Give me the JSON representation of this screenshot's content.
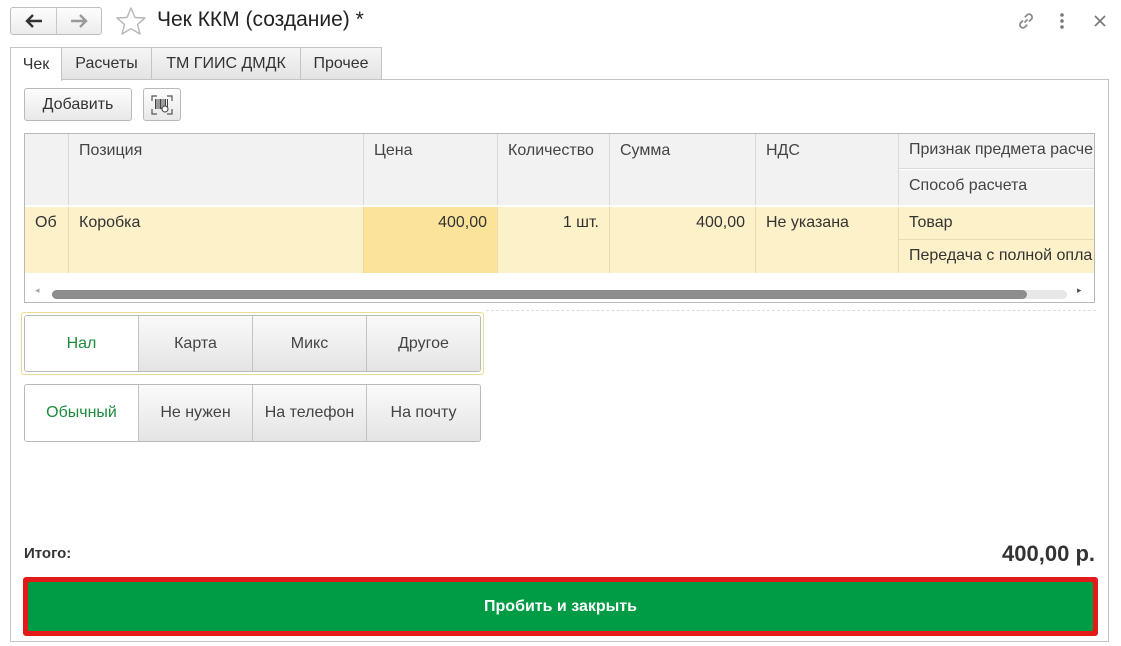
{
  "window": {
    "title": "Чек ККМ (создание) *",
    "icons": [
      "back-arrow-icon",
      "forward-arrow-icon",
      "favorite-star-icon",
      "link-icon",
      "more-vertical-icon",
      "close-icon"
    ]
  },
  "tabs": [
    {
      "label": "Чек",
      "active": true
    },
    {
      "label": "Расчеты",
      "active": false
    },
    {
      "label": "ТМ ГИИС ДМДК",
      "active": false
    },
    {
      "label": "Прочее",
      "active": false
    }
  ],
  "toolbar": {
    "add_label": "Добавить",
    "barcode_icon": "barcode-scan-icon"
  },
  "table": {
    "columns": {
      "position": "Позиция",
      "price": "Цена",
      "quantity": "Количество",
      "sum": "Сумма",
      "vat": "НДС",
      "subject": "Признак предмета расче",
      "method": "Способ расчета"
    },
    "rows": [
      {
        "code": "Об",
        "position": "Коробка",
        "price": "400,00",
        "quantity": "1 шт.",
        "sum": "400,00",
        "vat": "Не указана",
        "subject": "Товар",
        "method": "Передача с полной опла"
      }
    ]
  },
  "payment": {
    "options": [
      "Нал",
      "Карта",
      "Микс",
      "Другое"
    ],
    "selected": "Нал"
  },
  "receipt": {
    "options": [
      "Обычный",
      "Не нужен",
      "На телефон",
      "На почту"
    ],
    "selected": "Обычный"
  },
  "totals": {
    "label": "Итого:",
    "value": "400,00 р."
  },
  "actions": {
    "submit_label": "Пробить и закрыть"
  },
  "colors": {
    "accent_green": "#009b45",
    "selected_text": "#1e8a3c",
    "highlight_border": "#e21a1a",
    "row_highlight": "#fcf1c9"
  }
}
